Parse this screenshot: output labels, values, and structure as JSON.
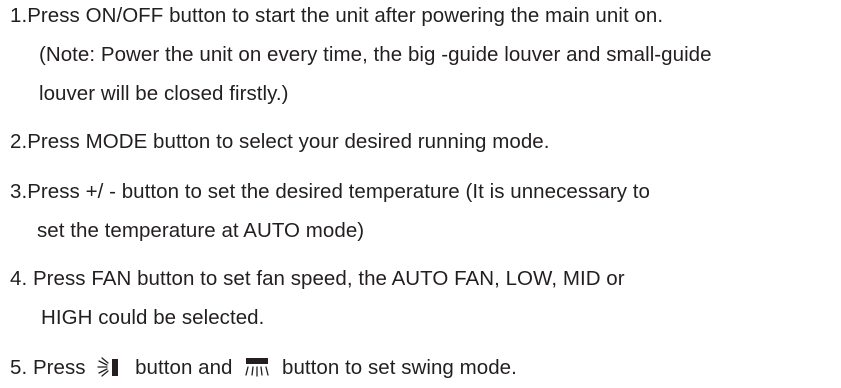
{
  "instructions": {
    "step1": {
      "line1": "1.Press ON/OFF button to start the unit after powering the main unit on.",
      "note_line1": "(Note: Power the unit on every time, the big -guide louver and small-guide",
      "note_line2": "louver will be closed firstly.)"
    },
    "step2": {
      "line1": "2.Press MODE button to select your desired running mode."
    },
    "step3": {
      "line1": "3.Press +/ - button to set the desired temperature (It is unnecessary  to",
      "line2": "set the temperature at AUTO mode)"
    },
    "step4": {
      "line1": "4. Press FAN button to set fan speed, the AUTO FAN, LOW, MID or",
      "line2": "HIGH could be selected."
    },
    "step5": {
      "prefix": "5. Press",
      "middle": "button and",
      "suffix": "button to set swing mode.",
      "icon1": "horizontal-swing-icon",
      "icon2": "vertical-swing-icon"
    }
  }
}
